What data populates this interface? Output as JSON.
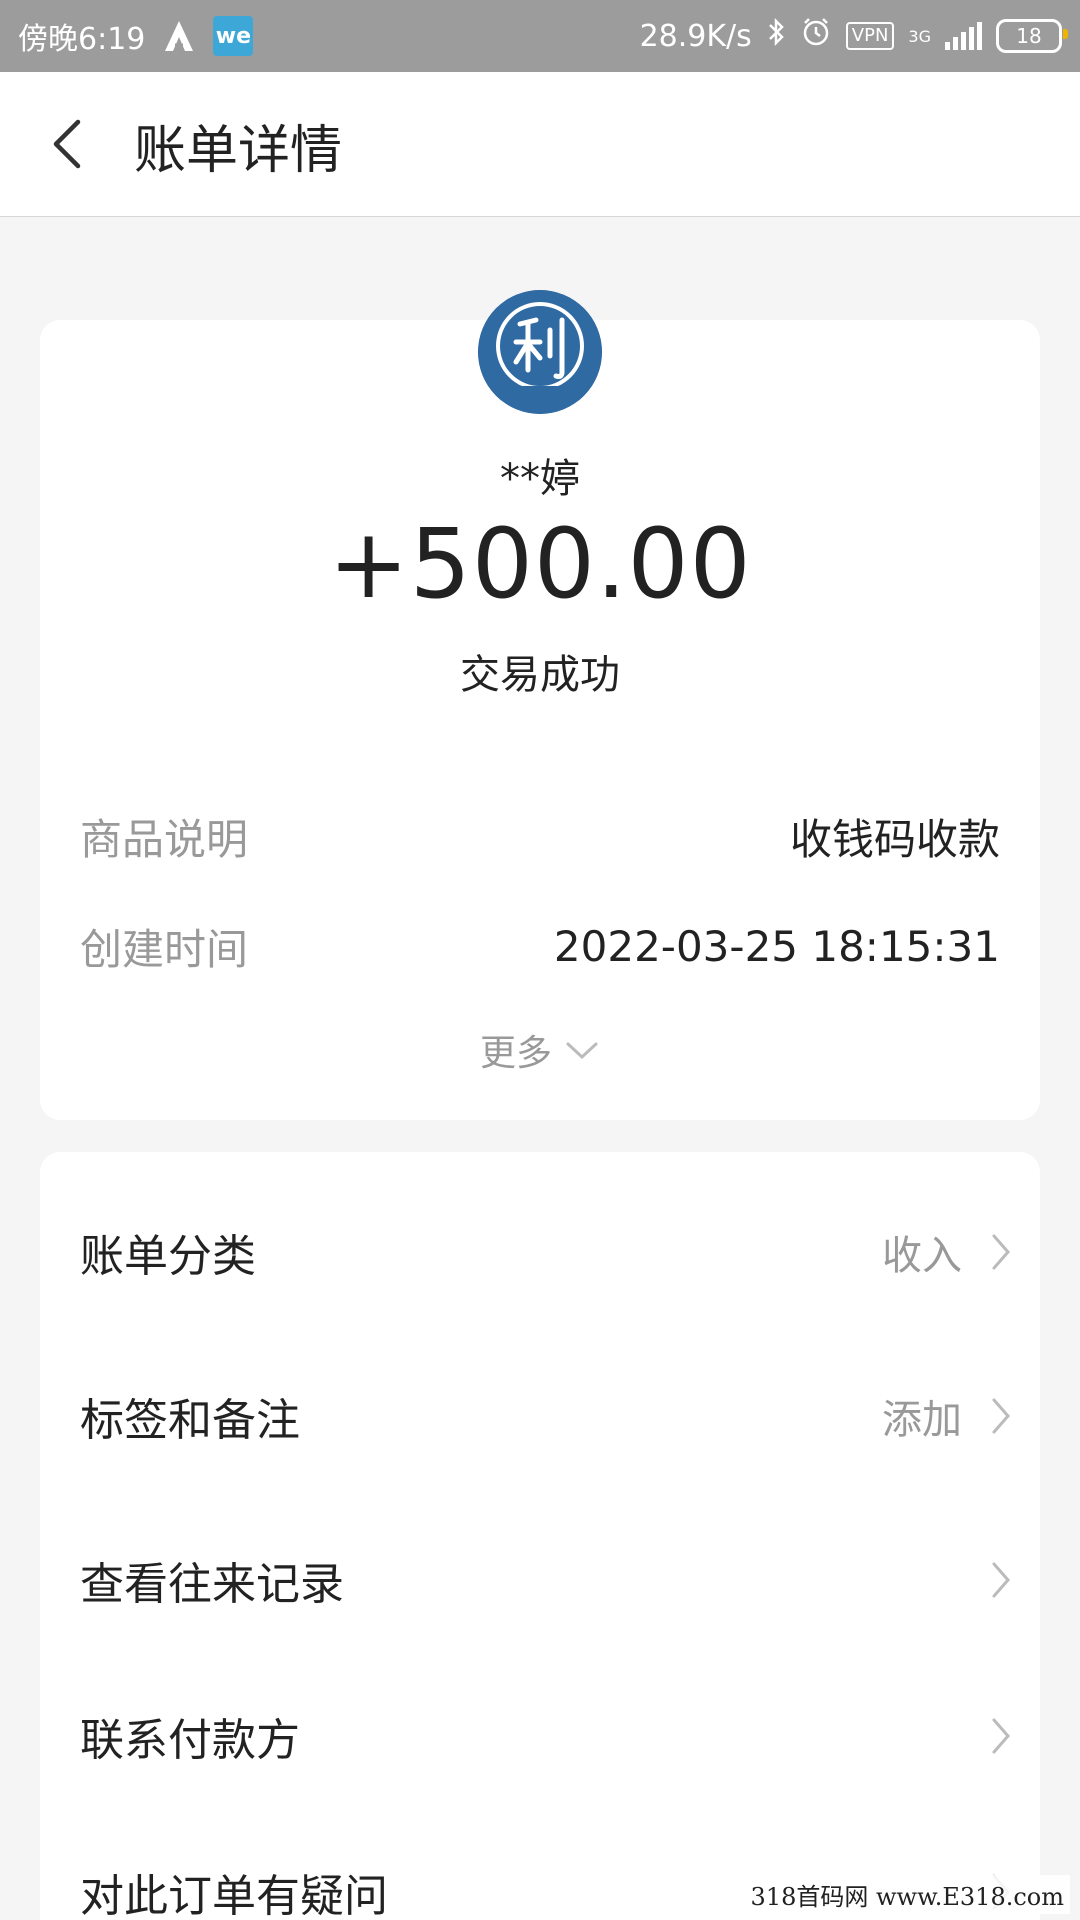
{
  "status_bar": {
    "time": "傍晚6:19",
    "app_icons": [
      "auto-navi-icon",
      "wechat-work-icon"
    ],
    "we_label": "we",
    "net_speed": "28.9K/s",
    "vpn": "VPN",
    "network": "3G",
    "battery": "18"
  },
  "header": {
    "title": "账单详情"
  },
  "summary": {
    "payer_name": "**婷",
    "amount": "+500.00",
    "status": "交易成功",
    "details": [
      {
        "label": "商品说明",
        "value": "收钱码收款"
      },
      {
        "label": "创建时间",
        "value": "2022-03-25 18:15:31"
      }
    ],
    "more_label": "更多"
  },
  "menu": {
    "items": [
      {
        "label": "账单分类",
        "value": "收入"
      },
      {
        "label": "标签和备注",
        "value": "添加"
      },
      {
        "label": "查看往来记录",
        "value": ""
      },
      {
        "label": "联系付款方",
        "value": ""
      },
      {
        "label": "对此订单有疑问",
        "value": ""
      }
    ]
  },
  "watermark": "318首码网 www.E318.com",
  "colors": {
    "status_bar_bg": "#9c9c9c",
    "avatar_bg": "#2f6aa3",
    "muted_text": "#999999"
  }
}
